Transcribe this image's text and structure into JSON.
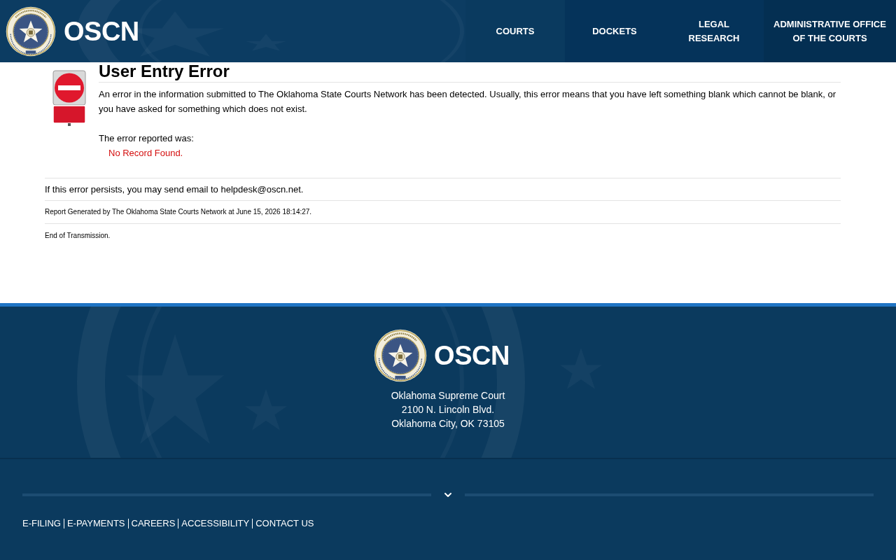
{
  "header": {
    "site_title": "OSCN",
    "nav": [
      {
        "label": "COURTS"
      },
      {
        "label": "DOCKETS"
      },
      {
        "label": "LEGAL RESEARCH"
      },
      {
        "label": "ADMINISTRATIVE OFFICE OF THE COURTS"
      }
    ]
  },
  "error": {
    "title": "User Entry Error",
    "message": "An error in the information submitted to The Oklahoma State Courts Network has been detected. Usually, this error means that you have left something blank which cannot be blank, or you have asked for something which does not exist.",
    "reported_label": "The error reported was:",
    "reported_error": "No Record Found."
  },
  "help_text": "If this error persists, you may send email to helpdesk@oscn.net.",
  "report_line": "Report Generated by The Oklahoma State Courts Network at June 15, 2026 18:14:27.",
  "end_line": "End of Transmission.",
  "footer": {
    "site_title": "OSCN",
    "address": [
      "Oklahoma Supreme Court",
      "2100 N. Lincoln Blvd.",
      "Oklahoma City, OK 73105"
    ],
    "links": [
      {
        "label": "E-FILING"
      },
      {
        "label": "E-PAYMENTS"
      },
      {
        "label": "CAREERS"
      },
      {
        "label": "ACCESSIBILITY"
      },
      {
        "label": "CONTACT US"
      }
    ]
  }
}
